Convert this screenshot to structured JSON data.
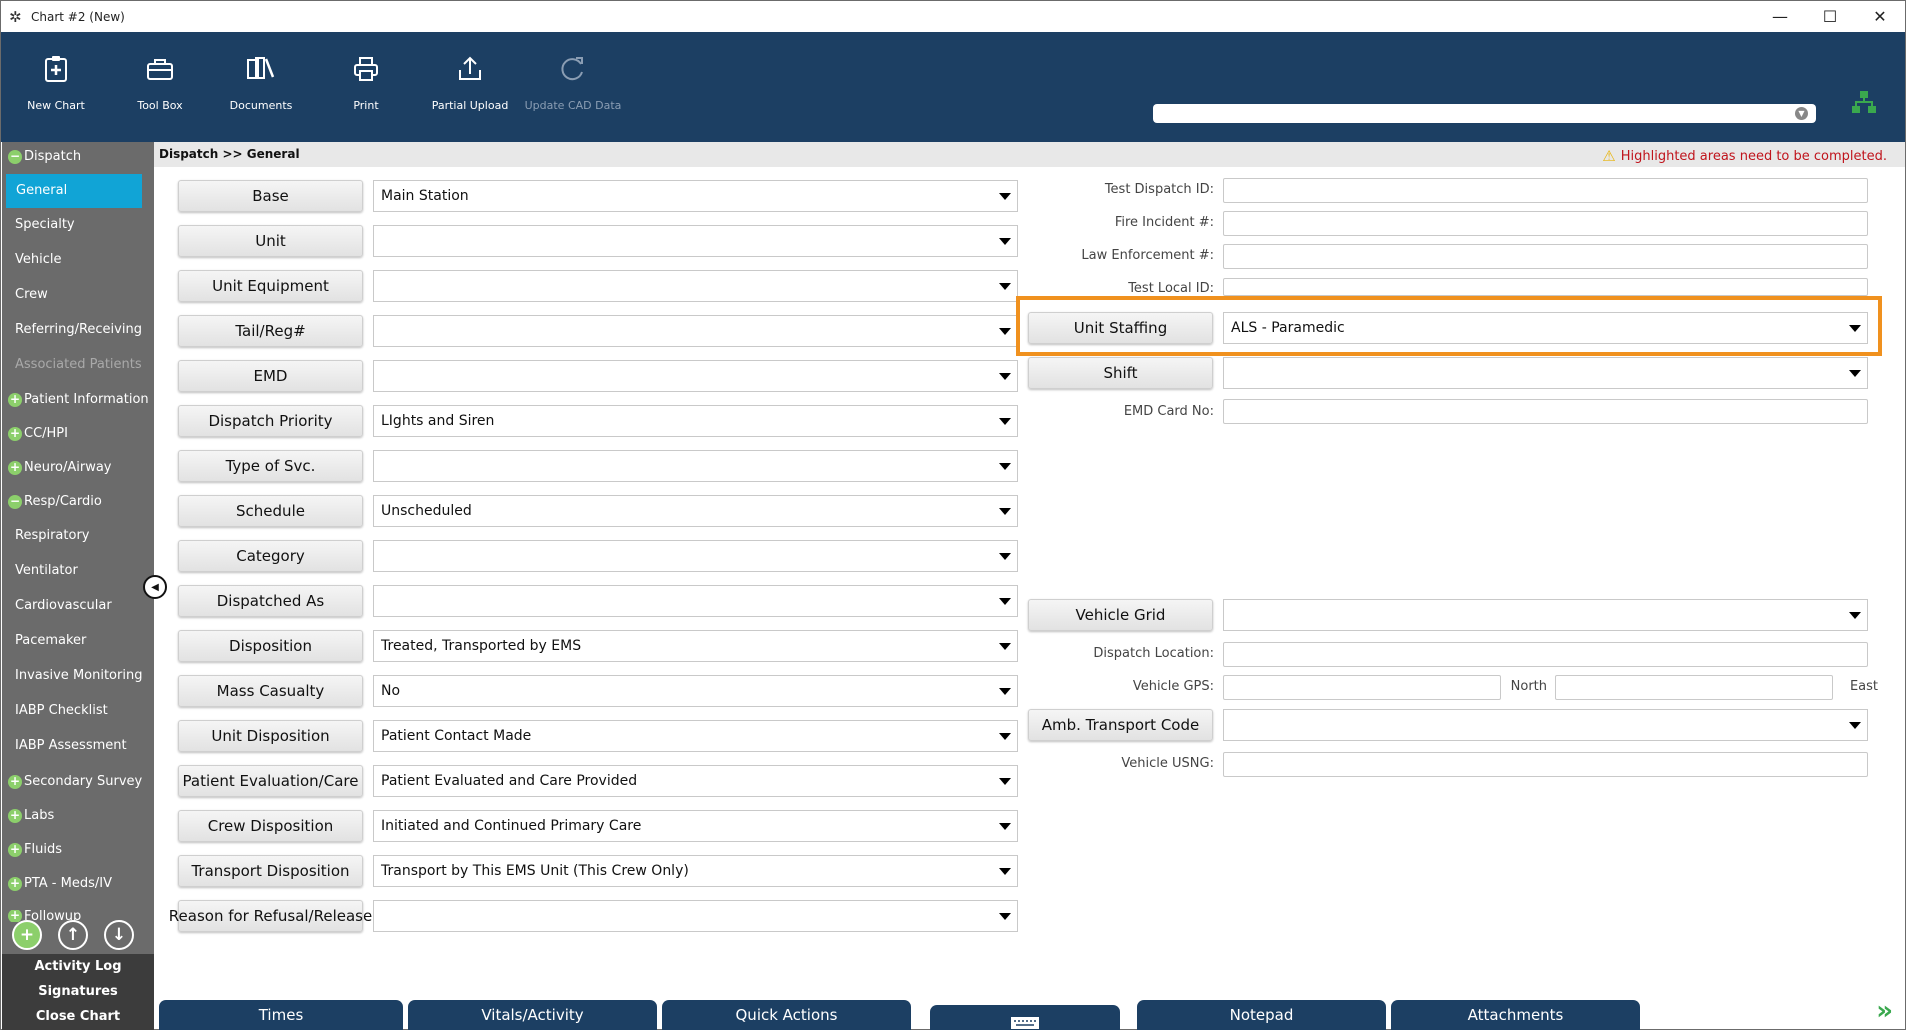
{
  "window": {
    "title": "Chart #2 (New)",
    "minimize": "—",
    "maximize": "☐",
    "close": "✕"
  },
  "toolbar": {
    "new_chart": "New Chart",
    "tool_box": "Tool Box",
    "documents": "Documents",
    "print": "Print",
    "partial_upload": "Partial Upload",
    "update_cad": "Update CAD Data"
  },
  "sidebar": {
    "dispatch": "Dispatch",
    "general": "General",
    "specialty": "Specialty",
    "vehicle": "Vehicle",
    "crew": "Crew",
    "referring": "Referring/Receiving",
    "associated": "Associated Patients",
    "patient_info": "Patient Information",
    "cc_hpi": "CC/HPI",
    "neuro": "Neuro/Airway",
    "resp_cardio": "Resp/Cardio",
    "respiratory": "Respiratory",
    "ventilator": "Ventilator",
    "cardiovascular": "Cardiovascular",
    "pacemaker": "Pacemaker",
    "invasive": "Invasive Monitoring",
    "iabp_checklist": "IABP Checklist",
    "iabp_assessment": "IABP Assessment",
    "secondary": "Secondary Survey",
    "labs": "Labs",
    "fluids": "Fluids",
    "pta": "PTA - Meds/IV",
    "followup": "Followup",
    "activity_log": "Activity Log",
    "signatures": "Signatures",
    "close_chart": "Close Chart"
  },
  "breadcrumb": "Dispatch >> General",
  "warning": "Highlighted areas need to be completed.",
  "left_fields": [
    {
      "label": "Base",
      "value": "Main Station"
    },
    {
      "label": "Unit",
      "value": ""
    },
    {
      "label": "Unit Equipment",
      "value": ""
    },
    {
      "label": "Tail/Reg#",
      "value": ""
    },
    {
      "label": "EMD",
      "value": ""
    },
    {
      "label": "Dispatch Priority",
      "value": "LIghts and Siren"
    },
    {
      "label": "Type of Svc.",
      "value": ""
    },
    {
      "label": "Schedule",
      "value": "Unscheduled"
    },
    {
      "label": "Category",
      "value": ""
    },
    {
      "label": "Dispatched As",
      "value": ""
    },
    {
      "label": "Disposition",
      "value": "Treated, Transported by EMS"
    },
    {
      "label": "Mass Casualty",
      "value": "No"
    },
    {
      "label": "Unit Disposition",
      "value": "Patient Contact Made"
    },
    {
      "label": "Patient Evaluation/Care",
      "value": "Patient Evaluated and Care Provided"
    },
    {
      "label": "Crew Disposition",
      "value": "Initiated and Continued Primary Care"
    },
    {
      "label": "Transport Disposition",
      "value": "Transport by This EMS Unit (This Crew Only)"
    },
    {
      "label": "Reason for Refusal/Release",
      "value": ""
    }
  ],
  "right": {
    "test_dispatch_id": "Test Dispatch ID:",
    "fire_incident": "Fire Incident #:",
    "law_enforcement": "Law Enforcement #:",
    "test_local_id": "Test Local ID:",
    "unit_staffing_label": "Unit Staffing",
    "unit_staffing_value": "ALS - Paramedic",
    "shift_label": "Shift",
    "shift_value": "",
    "emd_card_no": "EMD Card No:",
    "vehicle_grid_label": "Vehicle Grid",
    "vehicle_grid_value": "",
    "dispatch_location": "Dispatch Location:",
    "vehicle_gps": "Vehicle GPS:",
    "north": "North",
    "east": "East",
    "amb_transport_label": "Amb. Transport Code",
    "amb_transport_value": "",
    "vehicle_usng": "Vehicle USNG:"
  },
  "tabs": {
    "times": "Times",
    "vitals": "Vitals/Activity",
    "quick_actions": "Quick Actions",
    "notepad": "Notepad",
    "attachments": "Attachments"
  }
}
